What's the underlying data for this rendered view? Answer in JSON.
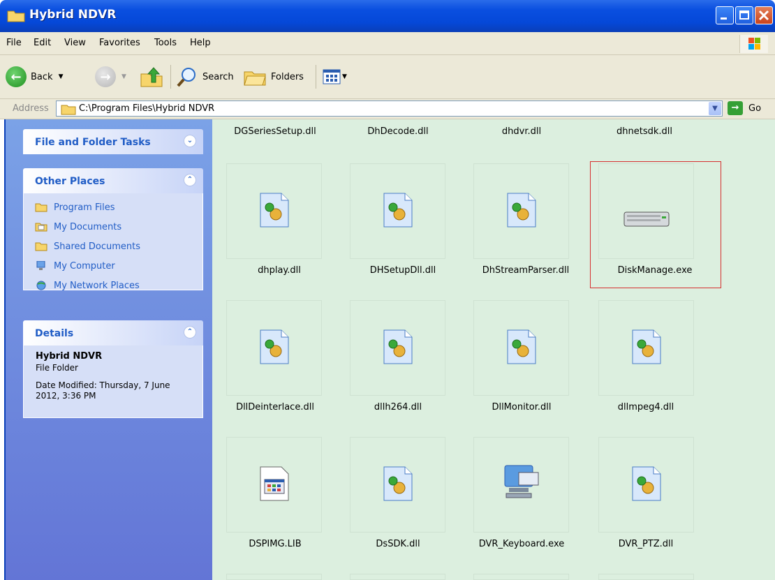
{
  "window": {
    "title": "Hybrid NDVR"
  },
  "menu": [
    "File",
    "Edit",
    "View",
    "Favorites",
    "Tools",
    "Help"
  ],
  "toolbar": {
    "back": "Back",
    "search": "Search",
    "folders": "Folders"
  },
  "address": {
    "label": "Address",
    "path": "C:\\Program Files\\Hybrid NDVR",
    "go": "Go"
  },
  "sidebar": {
    "file_tasks": {
      "title": "File and Folder Tasks"
    },
    "other_places": {
      "title": "Other Places",
      "items": [
        "Program Files",
        "My Documents",
        "Shared Documents",
        "My Computer",
        "My Network Places"
      ]
    },
    "details": {
      "title": "Details",
      "name": "Hybrid NDVR",
      "type": "File Folder",
      "date": "Date Modified: Thursday, 7 June 2012, 3:36 PM"
    }
  },
  "files": {
    "row0": [
      "DGSeriesSetup.dll",
      "DhDecode.dll",
      "dhdvr.dll",
      "dhnetsdk.dll"
    ],
    "row1": [
      "dhplay.dll",
      "DHSetupDll.dll",
      "DhStreamParser.dll",
      "DiskManage.exe"
    ],
    "row2": [
      "DllDeinterlace.dll",
      "dllh264.dll",
      "DllMonitor.dll",
      "dllmpeg4.dll"
    ],
    "row3": [
      "DSPIMG.LIB",
      "DsSDK.dll",
      "DVR_Keyboard.exe",
      "DVR_PTZ.dll"
    ]
  },
  "colors": {
    "title_blue": "#0548d8",
    "content_bg": "#dcefdf",
    "highlight": "#d62f2f"
  }
}
